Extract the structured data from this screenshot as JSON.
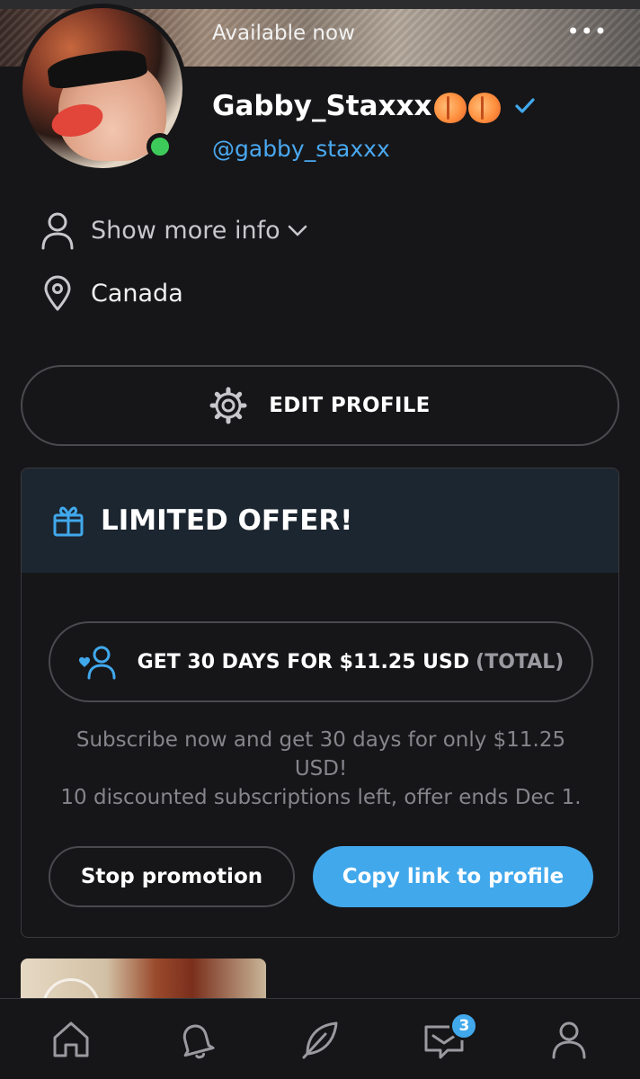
{
  "cover": {
    "status_text": "Available now",
    "menu_glyph": "•••"
  },
  "profile": {
    "display_name": "Gabby_Staxxx",
    "name_emoji": [
      "peach-emoji",
      "peach-emoji"
    ],
    "handle": "@gabby_staxxx",
    "verified": true,
    "online": true
  },
  "info": {
    "show_more_label": "Show more info",
    "location": "Canada"
  },
  "actions": {
    "edit_profile_label": "EDIT PROFILE"
  },
  "offer": {
    "title": "LIMITED OFFER!",
    "pill_main": "GET 30 DAYS FOR $11.25 USD",
    "pill_suffix": "(TOTAL)",
    "desc_line1": "Subscribe now and get 30 days for only $11.25",
    "desc_line2": "USD!",
    "desc_line3": "10 discounted subscriptions left, offer ends Dec 1.",
    "stop_label": "Stop promotion",
    "copy_label": "Copy link to profile"
  },
  "nav": {
    "items": [
      "home-icon",
      "bell-icon",
      "feather-icon",
      "messages-icon",
      "profile-icon"
    ],
    "messages_badge": "3"
  },
  "colors": {
    "background": "#161618",
    "accent": "#41a8ec",
    "online": "#3dca5a",
    "offer_header": "#1c2630"
  }
}
